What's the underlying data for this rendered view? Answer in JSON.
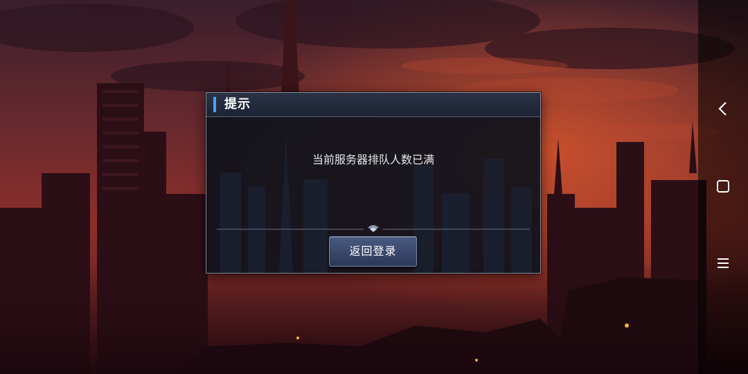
{
  "dialog": {
    "title": "提示",
    "message": "当前服务器排队人数已满",
    "return_login_label": "返回登录"
  },
  "navigation_bar": {
    "items": [
      {
        "icon": "back-icon"
      },
      {
        "icon": "home-icon"
      },
      {
        "icon": "recent-apps-icon"
      }
    ]
  },
  "colors": {
    "sky_top": "#3a1e2c",
    "sky_glow": "#c0402a",
    "dialog_bg": "#0e121c",
    "accent": "#4aa3ff",
    "button": "#3b4a6c"
  }
}
